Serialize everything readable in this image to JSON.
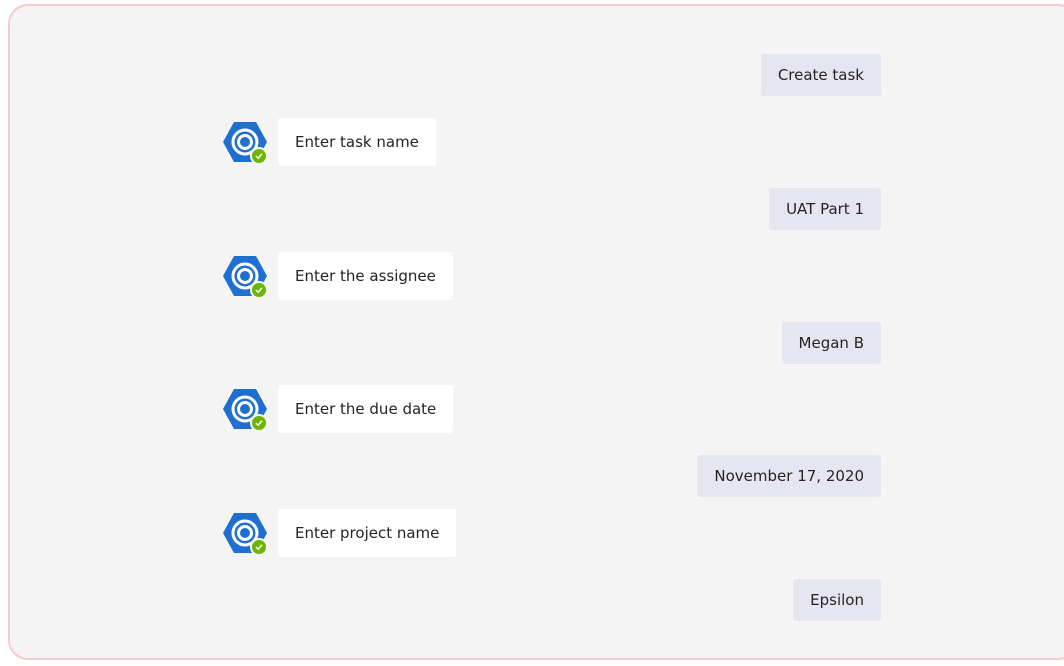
{
  "conversation": {
    "messages": [
      {
        "from": "user",
        "text": "Create task"
      },
      {
        "from": "bot",
        "text": "Enter task name",
        "icon": "bot-logo-icon",
        "status": "online-check-icon"
      },
      {
        "from": "user",
        "text": "UAT Part 1"
      },
      {
        "from": "bot",
        "text": "Enter the assignee",
        "icon": "bot-logo-icon",
        "status": "online-check-icon"
      },
      {
        "from": "user",
        "text": "Megan B"
      },
      {
        "from": "bot",
        "text": "Enter the due date",
        "icon": "bot-logo-icon",
        "status": "online-check-icon"
      },
      {
        "from": "user",
        "text": "November 17, 2020"
      },
      {
        "from": "bot",
        "text": "Enter project name",
        "icon": "bot-logo-icon",
        "status": "online-check-icon"
      },
      {
        "from": "user",
        "text": "Epsilon"
      }
    ]
  },
  "colors": {
    "user_bubble": "#e6e6f2",
    "bot_bubble": "#ffffff",
    "background": "#f4f4f4",
    "frame_border": "#f6c9cc",
    "bot_logo": "#1f6fd0",
    "status_badge": "#6bb700"
  }
}
